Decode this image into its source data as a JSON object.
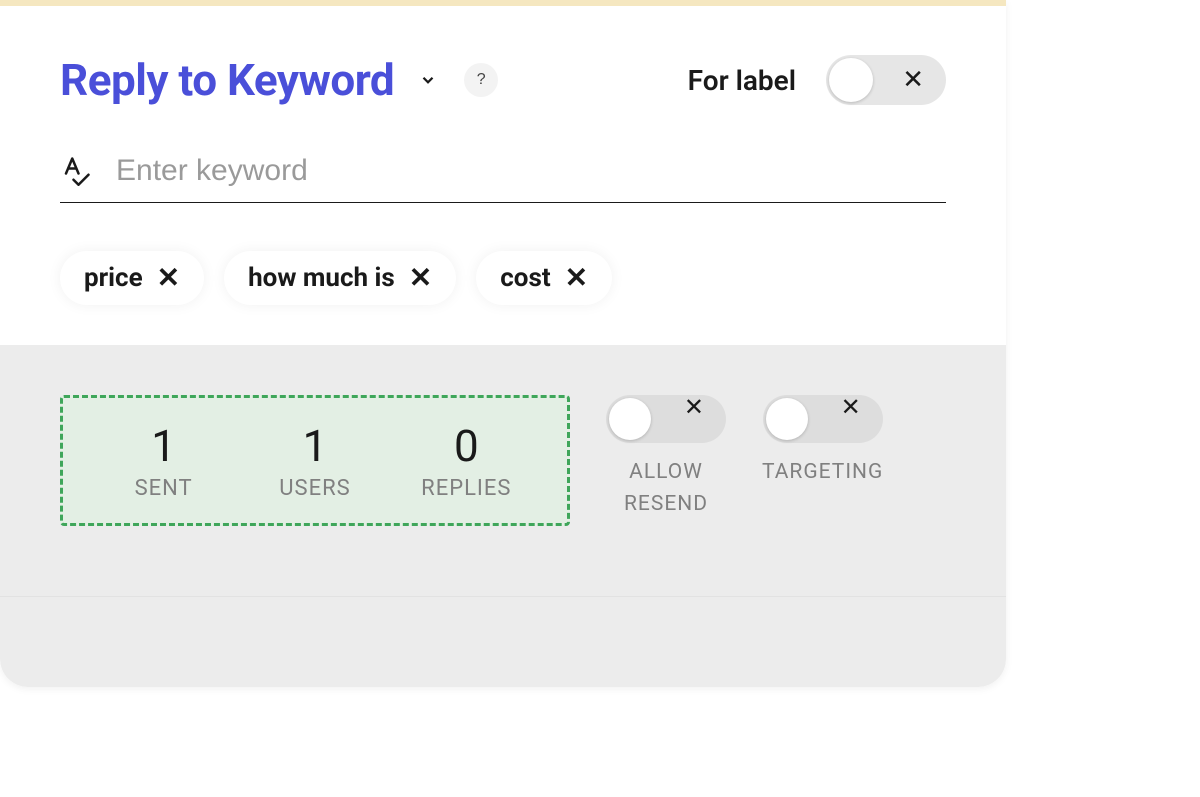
{
  "header": {
    "title": "Reply to Keyword",
    "help_symbol": "?",
    "for_label_text": "For label"
  },
  "input": {
    "placeholder": "Enter keyword",
    "value": ""
  },
  "chips": [
    {
      "label": "price"
    },
    {
      "label": "how much is"
    },
    {
      "label": "cost"
    }
  ],
  "stats": {
    "sent": {
      "value": "1",
      "label": "SENT"
    },
    "users": {
      "value": "1",
      "label": "USERS"
    },
    "replies": {
      "value": "0",
      "label": "REPLIES"
    }
  },
  "toggles": {
    "for_label": {
      "on": false,
      "off_symbol": "✕"
    },
    "allow_resend": {
      "label": "ALLOW\nRESEND",
      "on": false,
      "off_symbol": "✕"
    },
    "targeting": {
      "label": "TARGETING",
      "on": false,
      "off_symbol": "✕"
    }
  }
}
